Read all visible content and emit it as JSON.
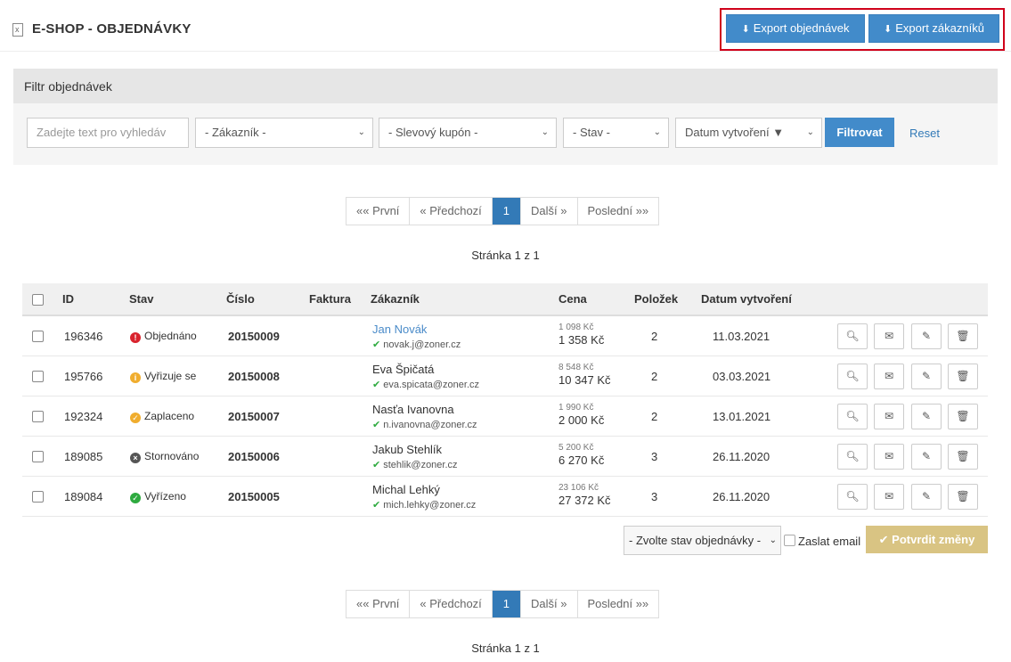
{
  "header": {
    "title": "E-SHOP - OBJEDNÁVKY",
    "export_orders": "Export objednávek",
    "export_customers": "Export zákazníků"
  },
  "filter": {
    "heading": "Filtr objednávek",
    "search_placeholder": "Zadejte text pro vyhledáv",
    "customer_select": "- Zákazník -",
    "coupon_select": "- Slevový kupón -",
    "status_select": "- Stav -",
    "sort_select": "Datum vytvoření ▼",
    "filter_button": "Filtrovat",
    "reset_link": "Reset"
  },
  "pagination": {
    "first": "«« První",
    "prev": "« Předchozí",
    "current": "1",
    "next": "Další »",
    "last": "Poslední »»",
    "info": "Stránka 1 z 1"
  },
  "table": {
    "headers": {
      "id": "ID",
      "status": "Stav",
      "number": "Číslo",
      "invoice": "Faktura",
      "customer": "Zákazník",
      "price": "Cena",
      "items": "Položek",
      "created": "Datum vytvoření"
    },
    "rows": [
      {
        "id": "196346",
        "status": "Objednáno",
        "status_color": "#d9232d",
        "status_glyph": "!",
        "number": "20150009",
        "name": "Jan Novák",
        "name_link": true,
        "email": "novak.j@zoner.cz",
        "price_small": "1 098 Kč",
        "price_big": "1 358 Kč",
        "items": "2",
        "date": "11.03.2021"
      },
      {
        "id": "195766",
        "status": "Vyřizuje se",
        "status_color": "#f0ad2e",
        "status_glyph": "i",
        "number": "20150008",
        "name": "Eva Špičatá",
        "name_link": false,
        "email": "eva.spicata@zoner.cz",
        "price_small": "8 548 Kč",
        "price_big": "10 347 Kč",
        "items": "2",
        "date": "03.03.2021"
      },
      {
        "id": "192324",
        "status": "Zaplaceno",
        "status_color": "#f0ad2e",
        "status_glyph": "✓",
        "number": "20150007",
        "name": "Nasťa Ivanovna",
        "name_link": false,
        "email": "n.ivanovna@zoner.cz",
        "price_small": "1 990 Kč",
        "price_big": "2 000 Kč",
        "items": "2",
        "date": "13.01.2021"
      },
      {
        "id": "189085",
        "status": "Stornováno",
        "status_color": "#555555",
        "status_glyph": "×",
        "number": "20150006",
        "name": "Jakub Stehlík",
        "name_link": false,
        "email": "stehlik@zoner.cz",
        "price_small": "5 200 Kč",
        "price_big": "6 270 Kč",
        "items": "3",
        "date": "26.11.2020"
      },
      {
        "id": "189084",
        "status": "Vyřízeno",
        "status_color": "#2eaa3f",
        "status_glyph": "✓",
        "number": "20150005",
        "name": "Michal Lehký",
        "name_link": false,
        "email": "mich.lehky@zoner.cz",
        "price_small": "23 106 Kč",
        "price_big": "27 372 Kč",
        "items": "3",
        "date": "26.11.2020"
      }
    ]
  },
  "bulk": {
    "status_select": "- Zvolte stav objednávky -",
    "send_email_label": "Zaslat email",
    "confirm_button": "✔ Potvrdit změny"
  },
  "colors": {
    "primary": "#428bca",
    "confirm": "#d9c483",
    "highlight_frame": "#d0021b",
    "link": "#337ab7"
  }
}
